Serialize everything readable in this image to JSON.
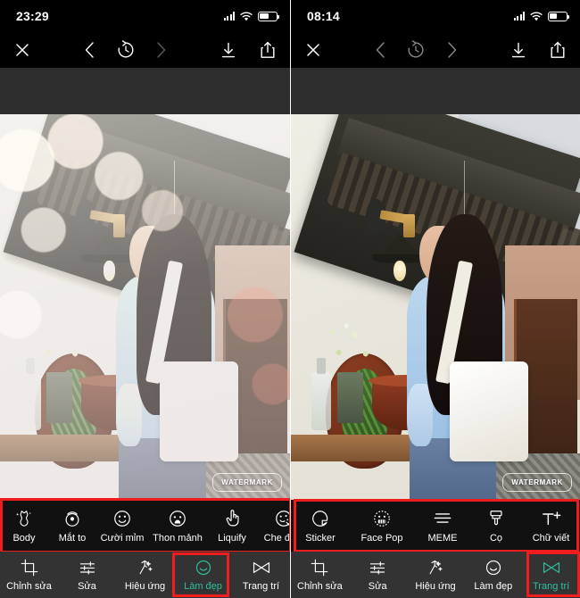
{
  "panels": [
    {
      "id": "left",
      "status": {
        "time": "23:29",
        "signal_icon": "cellular-signal-icon",
        "wifi_icon": "wifi-icon",
        "battery_icon": "battery-icon",
        "battery_level": "55"
      },
      "nav": {
        "close_icon": "close-icon",
        "prev_icon": "chevron-left-icon",
        "history_icon": "history-revert-icon",
        "next_icon": "chevron-right-icon",
        "download_icon": "download-icon",
        "share_icon": "share-icon",
        "prev_state": "enabled",
        "history_state": "enabled",
        "next_state": "disabled"
      },
      "photo": {
        "watermark": "WATERMARK",
        "filter": "faded-light-leak"
      },
      "toolstrip": {
        "highlighted": true,
        "items": [
          {
            "label": "Body",
            "icon": "body-shape-icon"
          },
          {
            "label": "Mắt to",
            "icon": "big-eyes-icon"
          },
          {
            "label": "Cười mỉm",
            "icon": "smile-icon"
          },
          {
            "label": "Thon mảnh",
            "icon": "slim-face-icon"
          },
          {
            "label": "Liquify",
            "icon": "liquify-hand-icon"
          },
          {
            "label": "Che đốm",
            "icon": "blemish-remover-icon"
          }
        ]
      },
      "tabbar": {
        "active_index": 3,
        "items": [
          {
            "label": "Chỉnh sửa",
            "icon": "crop-icon"
          },
          {
            "label": "Sửa",
            "icon": "adjust-sliders-icon"
          },
          {
            "label": "Hiệu ứng",
            "icon": "effects-sparkle-icon"
          },
          {
            "label": "Làm đẹp",
            "icon": "beautify-smile-icon"
          },
          {
            "label": "Trang trí",
            "icon": "decorate-bowtie-icon"
          }
        ]
      }
    },
    {
      "id": "right",
      "status": {
        "time": "08:14",
        "signal_icon": "cellular-signal-icon",
        "wifi_icon": "wifi-icon",
        "battery_icon": "battery-icon",
        "battery_level": "45"
      },
      "nav": {
        "close_icon": "close-icon",
        "prev_icon": "chevron-left-icon",
        "history_icon": "history-revert-icon",
        "next_icon": "chevron-right-icon",
        "download_icon": "download-icon",
        "share_icon": "share-icon",
        "prev_state": "disabled",
        "history_state": "disabled",
        "next_state": "disabled"
      },
      "photo": {
        "watermark": "WATERMARK",
        "filter": "none"
      },
      "toolstrip": {
        "highlighted": true,
        "items": [
          {
            "label": "Sticker",
            "icon": "sticker-icon"
          },
          {
            "label": "Face Pop",
            "icon": "face-pop-icon"
          },
          {
            "label": "MEME",
            "icon": "meme-lines-icon"
          },
          {
            "label": "Cọ",
            "icon": "brush-icon"
          },
          {
            "label": "Chữ viết",
            "icon": "text-add-icon"
          }
        ]
      },
      "tabbar": {
        "active_index": 4,
        "items": [
          {
            "label": "Chỉnh sửa",
            "icon": "crop-icon"
          },
          {
            "label": "Sửa",
            "icon": "adjust-sliders-icon"
          },
          {
            "label": "Hiệu ứng",
            "icon": "effects-sparkle-icon"
          },
          {
            "label": "Làm đẹp",
            "icon": "beautify-smile-icon"
          },
          {
            "label": "Trang trí",
            "icon": "decorate-bowtie-icon"
          }
        ]
      }
    }
  ],
  "colors": {
    "highlight_red": "#ef1d1d",
    "active_teal": "#2fbfa0",
    "tabbar_bg": "#333333",
    "toolstrip_bg": "#111111",
    "nav_bg": "#000000",
    "gap_band": "#2d2d2d"
  }
}
